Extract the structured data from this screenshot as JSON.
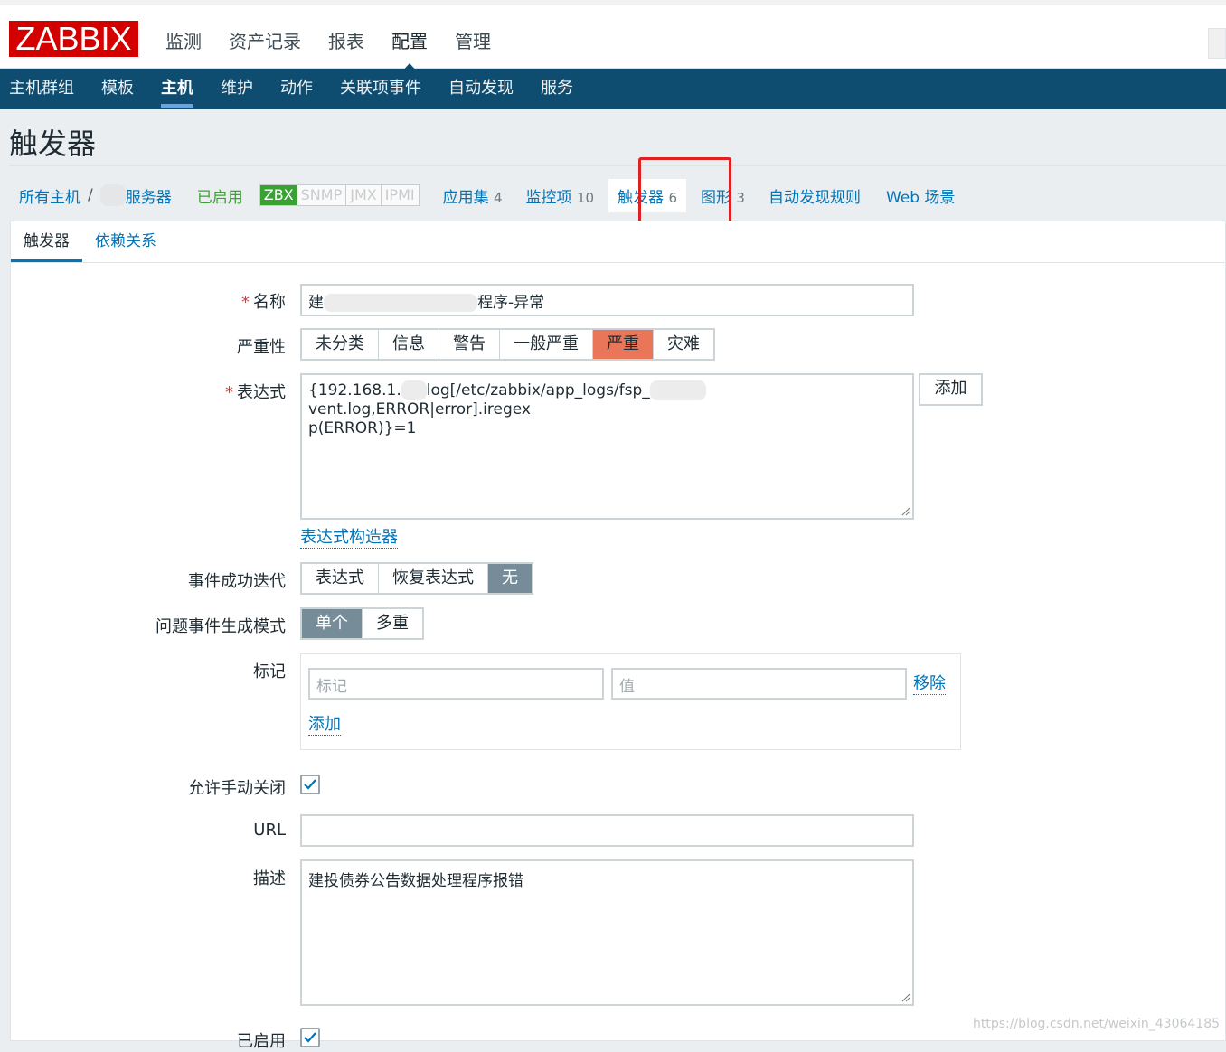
{
  "brand": {
    "logo_text": "ZABBIX",
    "color": "#d40000"
  },
  "main_menu": [
    {
      "label": "监测"
    },
    {
      "label": "资产记录"
    },
    {
      "label": "报表"
    },
    {
      "label": "配置",
      "selected": true
    },
    {
      "label": "管理"
    }
  ],
  "sub_menu": [
    {
      "label": "主机群组"
    },
    {
      "label": "模板"
    },
    {
      "label": "主机",
      "selected": true
    },
    {
      "label": "维护"
    },
    {
      "label": "动作"
    },
    {
      "label": "关联项事件"
    },
    {
      "label": "自动发现"
    },
    {
      "label": "服务"
    }
  ],
  "page_title": "触发器",
  "host_nav": {
    "all_hosts": "所有主机",
    "separator": "/",
    "host_name": "服务器",
    "status": "已启用",
    "availability": [
      "ZBX",
      "SNMP",
      "JMX",
      "IPMI"
    ],
    "links": [
      {
        "label": "应用集",
        "count": "4"
      },
      {
        "label": "监控项",
        "count": "10"
      },
      {
        "label": "触发器",
        "count": "6",
        "active": true
      },
      {
        "label": "图形",
        "count": "3"
      },
      {
        "label": "自动发现规则",
        "count": ""
      },
      {
        "label": "Web 场景",
        "count": ""
      }
    ]
  },
  "tabs": [
    {
      "label": "触发器",
      "active": true
    },
    {
      "label": "依赖关系"
    }
  ],
  "form": {
    "name": {
      "label": "名称",
      "required": true,
      "value_prefix": "建",
      "value_suffix": "程序-异常"
    },
    "severity": {
      "label": "严重性",
      "options": [
        "未分类",
        "信息",
        "警告",
        "一般严重",
        "严重",
        "灾难"
      ],
      "selected": "严重"
    },
    "expression": {
      "label": "表达式",
      "required": true,
      "value_part1": "{192.168.1.",
      "value_part2": "log[/etc/zabbix/app_logs/fsp_",
      "value_part3": "vent.log,ERROR|error].iregex",
      "value_line2": "p(ERROR)}=1",
      "add_button": "添加",
      "constructor_link": "表达式构造器"
    },
    "ok_event_generation": {
      "label": "事件成功迭代",
      "options": [
        "表达式",
        "恢复表达式",
        "无"
      ],
      "selected": "无"
    },
    "problem_mode": {
      "label": "问题事件生成模式",
      "options": [
        "单个",
        "多重"
      ],
      "selected": "单个"
    },
    "tags": {
      "label": "标记",
      "tag_placeholder": "标记",
      "value_placeholder": "值",
      "remove_link": "移除",
      "add_link": "添加"
    },
    "manual_close": {
      "label": "允许手动关闭",
      "checked": true
    },
    "url": {
      "label": "URL",
      "value": ""
    },
    "description": {
      "label": "描述",
      "value": "建投债券公告数据处理程序报错"
    },
    "enabled": {
      "label": "已启用",
      "checked": true
    }
  },
  "watermark": "https://blog.csdn.net/weixin_43064185"
}
